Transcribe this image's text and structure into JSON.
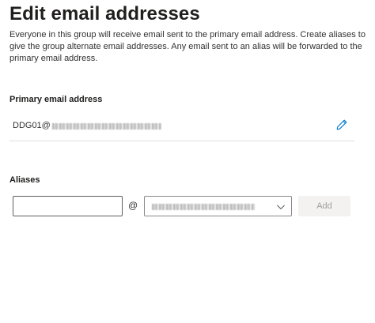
{
  "header": {
    "title": "Edit email addresses",
    "description": "Everyone in this group will receive email sent to the primary email address. Create aliases to give the group alternate email addresses. Any email sent to an alias will be forwarded to the primary email address."
  },
  "primary": {
    "label": "Primary email address",
    "value_prefix": "DDG01@",
    "edit_icon": "pencil-icon"
  },
  "aliases": {
    "label": "Aliases",
    "input_value": "",
    "at_symbol": "@",
    "domain_chevron_icon": "chevron-down-icon",
    "add_label": "Add"
  },
  "colors": {
    "accent": "#0078d4",
    "disabled_bg": "#f3f2f1",
    "disabled_text": "#a19f9d",
    "divider": "#e1dfdd"
  }
}
